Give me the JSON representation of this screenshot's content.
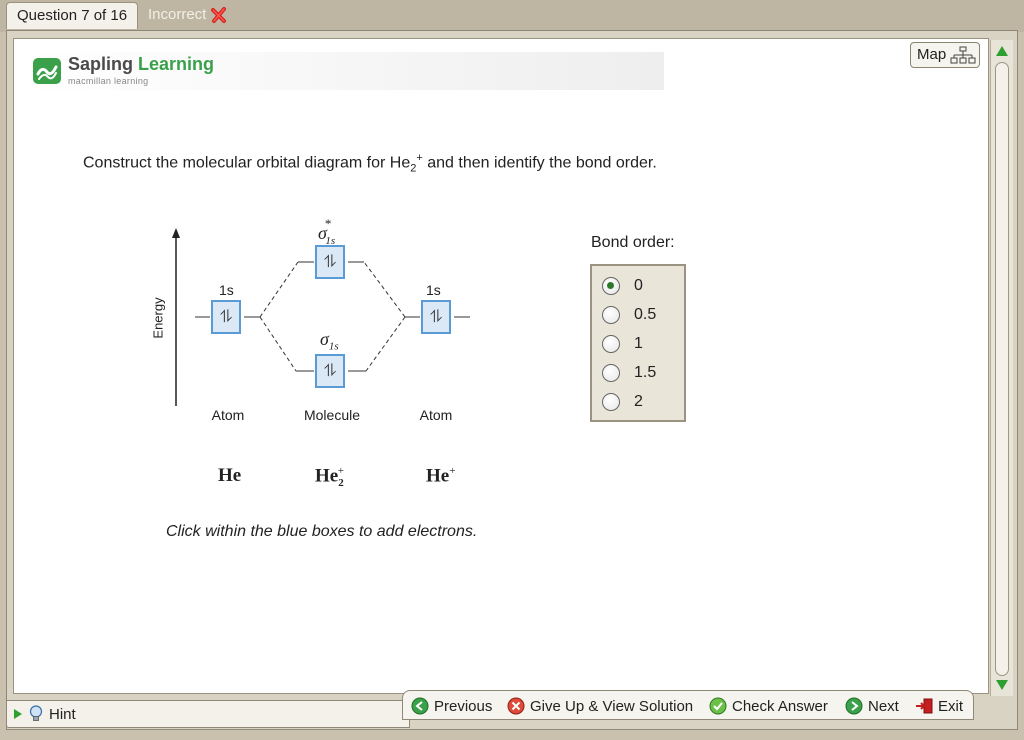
{
  "tabs": {
    "question": "Question 7 of 16",
    "status": "Incorrect"
  },
  "brand": {
    "title_part1": "Sapling",
    "title_part2": "Learning",
    "subtitle": "macmillan learning",
    "accent_color": "#3aa14a"
  },
  "map_button": {
    "label": "Map"
  },
  "question": {
    "prefix": "Construct the molecular orbital diagram for He",
    "sub": "2",
    "sup": "+",
    "suffix": " and then identify the bond order."
  },
  "diagram": {
    "energy_label": "Energy",
    "left_atom": {
      "orbital_label": "1s",
      "electrons": "⥮",
      "column_label": "Atom",
      "species": "He"
    },
    "right_atom": {
      "orbital_label": "1s",
      "electrons": "⥮",
      "column_label": "Atom",
      "species": "He",
      "species_charge": "+"
    },
    "molecule": {
      "antibonding_label": "σ",
      "antibonding_sub": "1s",
      "antibonding_sup": "*",
      "antibonding_electrons": "⥮",
      "bonding_label": "σ",
      "bonding_sub": "1s",
      "bonding_electrons": "⥮",
      "column_label": "Molecule",
      "species": "He",
      "species_sub": "2",
      "species_charge": "+"
    },
    "instruction": "Click within the blue boxes to add electrons."
  },
  "bond_order": {
    "label": "Bond order:",
    "options": [
      "0",
      "0.5",
      "1",
      "1.5",
      "2"
    ],
    "selected": "0"
  },
  "hint": {
    "label": "Hint"
  },
  "nav": {
    "previous": "Previous",
    "give_up": "Give Up & View Solution",
    "check": "Check Answer",
    "next": "Next",
    "exit": "Exit"
  }
}
